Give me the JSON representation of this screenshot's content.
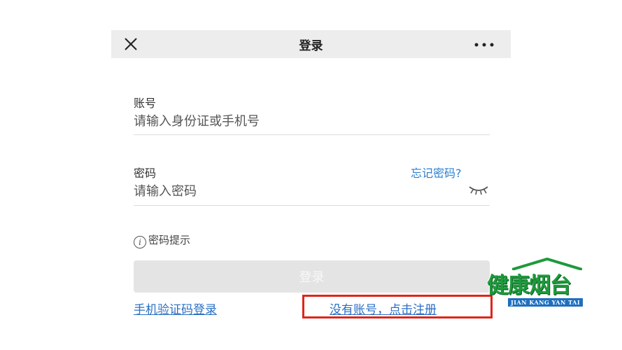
{
  "header": {
    "title": "登录"
  },
  "account": {
    "label": "账号",
    "placeholder": "请输入身份证或手机号",
    "value": ""
  },
  "password": {
    "label": "密码",
    "placeholder": "请输入密码",
    "value": "",
    "forgot_label": "忘记密码?"
  },
  "hint": {
    "label": "密码提示"
  },
  "login_button": {
    "label": "登录"
  },
  "links": {
    "sms_login": "手机验证码登录",
    "register": "没有账号，点击注册"
  },
  "logo": {
    "text": "健康烟台",
    "subtitle": "JIAN KANG YAN TAI"
  },
  "colors": {
    "link": "#2a6fc4",
    "highlight": "#e0251b",
    "button_disabled": "#e4e4e4",
    "topbar": "#ededed",
    "logo_green": "#1e9a3c"
  },
  "icons": [
    "close-icon",
    "more-icon",
    "eye-closed-icon",
    "info-icon"
  ]
}
